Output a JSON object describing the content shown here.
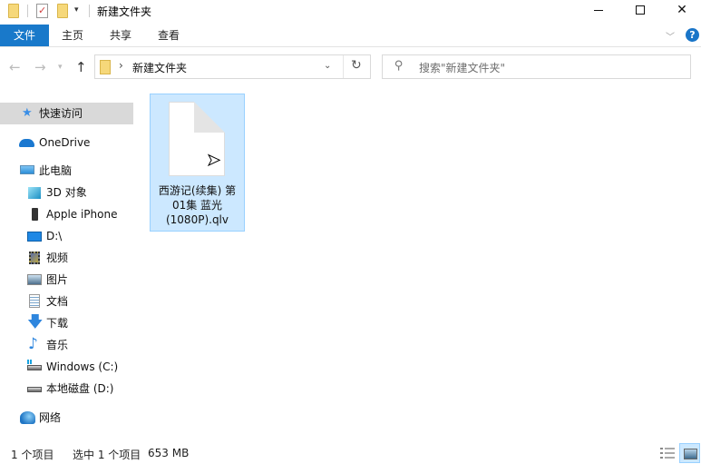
{
  "window": {
    "title": "新建文件夹",
    "controls": {
      "minimize": "minimize",
      "maximize": "maximize",
      "close": "✕"
    }
  },
  "quick_access_toolbar": {
    "icons": [
      "folder-icon",
      "properties-icon",
      "new-folder-icon",
      "customize-dropdown-icon"
    ],
    "dropdown_glyph": "▾"
  },
  "ribbon": {
    "tabs": [
      {
        "label": "文件",
        "active": true
      },
      {
        "label": "主页"
      },
      {
        "label": "共享"
      },
      {
        "label": "查看"
      }
    ],
    "expand_glyph": "﹀",
    "help_glyph": "?"
  },
  "navigation": {
    "back_glyph": "←",
    "forward_glyph": "→",
    "recent_glyph": "▾",
    "up_glyph": "↑",
    "address": {
      "separator": "›",
      "path": "新建文件夹",
      "dropdown_glyph": "⌄",
      "refresh_glyph": "↻"
    },
    "search": {
      "icon_glyph": "⚲",
      "placeholder": "搜索\"新建文件夹\""
    }
  },
  "sidebar": {
    "items": [
      {
        "label": "快速访问",
        "icon": "star-pin-icon",
        "selected": true
      },
      {
        "label": "OneDrive",
        "icon": "cloud-icon"
      },
      {
        "label": "此电脑",
        "icon": "computer-icon"
      },
      {
        "label": "3D 对象",
        "icon": "cube-3d-icon"
      },
      {
        "label": "Apple iPhone",
        "icon": "phone-icon"
      },
      {
        "label": "D:\\",
        "icon": "monitor-drive-icon"
      },
      {
        "label": "视频",
        "icon": "video-icon"
      },
      {
        "label": "图片",
        "icon": "picture-icon"
      },
      {
        "label": "文档",
        "icon": "document-icon"
      },
      {
        "label": "下载",
        "icon": "download-icon"
      },
      {
        "label": "音乐",
        "icon": "music-icon"
      },
      {
        "label": "Windows (C:)",
        "icon": "windows-drive-icon"
      },
      {
        "label": "本地磁盘 (D:)",
        "icon": "disk-drive-icon"
      },
      {
        "label": "网络",
        "icon": "network-icon"
      }
    ]
  },
  "files": [
    {
      "name_lines": [
        "西游记(续集) 第",
        "01集 蓝光",
        "(1080P).qlv"
      ],
      "selected": true,
      "icon": "generic-file-icon"
    }
  ],
  "status": {
    "item_count": "1 个项目",
    "selected": "选中 1 个项目",
    "size": "653 MB"
  },
  "colors": {
    "accent": "#1979ca",
    "selection_bg": "#cce8ff",
    "selection_border": "#99d1ff",
    "sidebar_selected": "#d9d9d9"
  }
}
